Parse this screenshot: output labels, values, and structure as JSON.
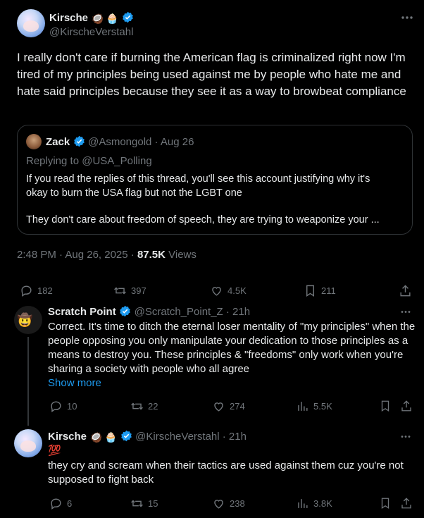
{
  "main_tweet": {
    "author_name": "Kirsche",
    "author_emojis": "🥥 🧁",
    "author_handle": "@KirscheVerstahl",
    "text": "I really don't care if burning the American flag is criminalized right now I'm tired of my principles being used against me by people who hate me and hate said principles because they see it as a way to browbeat compliance",
    "timestamp": "2:48 PM · Aug 26, 2025 · ",
    "views_count": "87.5K",
    "views_label": " Views",
    "replies": "182",
    "reposts": "397",
    "likes": "4.5K",
    "bookmarks": "211"
  },
  "quote": {
    "author_name": "Zack",
    "author_handle": "@Asmongold · Aug 26",
    "replying_to_prefix": "Replying to ",
    "replying_to_handle": "@USA_Polling",
    "text_line1": "If you read the replies of this thread, you'll see this account justifying why it's",
    "text_line2": "okay to burn the USA flag but not the LGBT one",
    "text_line3": "They don't care about freedom of speech, they are trying to weaponize your ..."
  },
  "reply1": {
    "author_name": "Scratch Point",
    "author_handle": "@Scratch_Point_Z · 21h",
    "text": "Correct. It's time to ditch the eternal loser mentality of \"my principles\" when the people opposing you only manipulate your dedication to those principles as a means to destroy you. These principles & \"freedoms\" only work when you're sharing a society with people who all agree",
    "show_more": "Show more",
    "replies": "10",
    "reposts": "22",
    "likes": "274",
    "views": "5.5K"
  },
  "reply2": {
    "author_name": "Kirsche",
    "author_emojis": "🥥 🧁",
    "author_handle": "@KirscheVerstahl · 21h",
    "emoji_line": "💯",
    "text": "they cry and scream when their tactics are used against them cuz you're not supposed to fight back",
    "replies": "6",
    "reposts": "15",
    "likes": "238",
    "views": "3.8K"
  },
  "colors": {
    "background": "#000000",
    "text": "#e7e9ea",
    "muted": "#71767b",
    "accent": "#1d9bf0",
    "border": "#2f3336"
  },
  "icons": [
    "grok-icon",
    "more-icon",
    "verified-icon",
    "reply-icon",
    "repost-icon",
    "like-icon",
    "bookmark-icon",
    "share-icon",
    "views-icon"
  ]
}
